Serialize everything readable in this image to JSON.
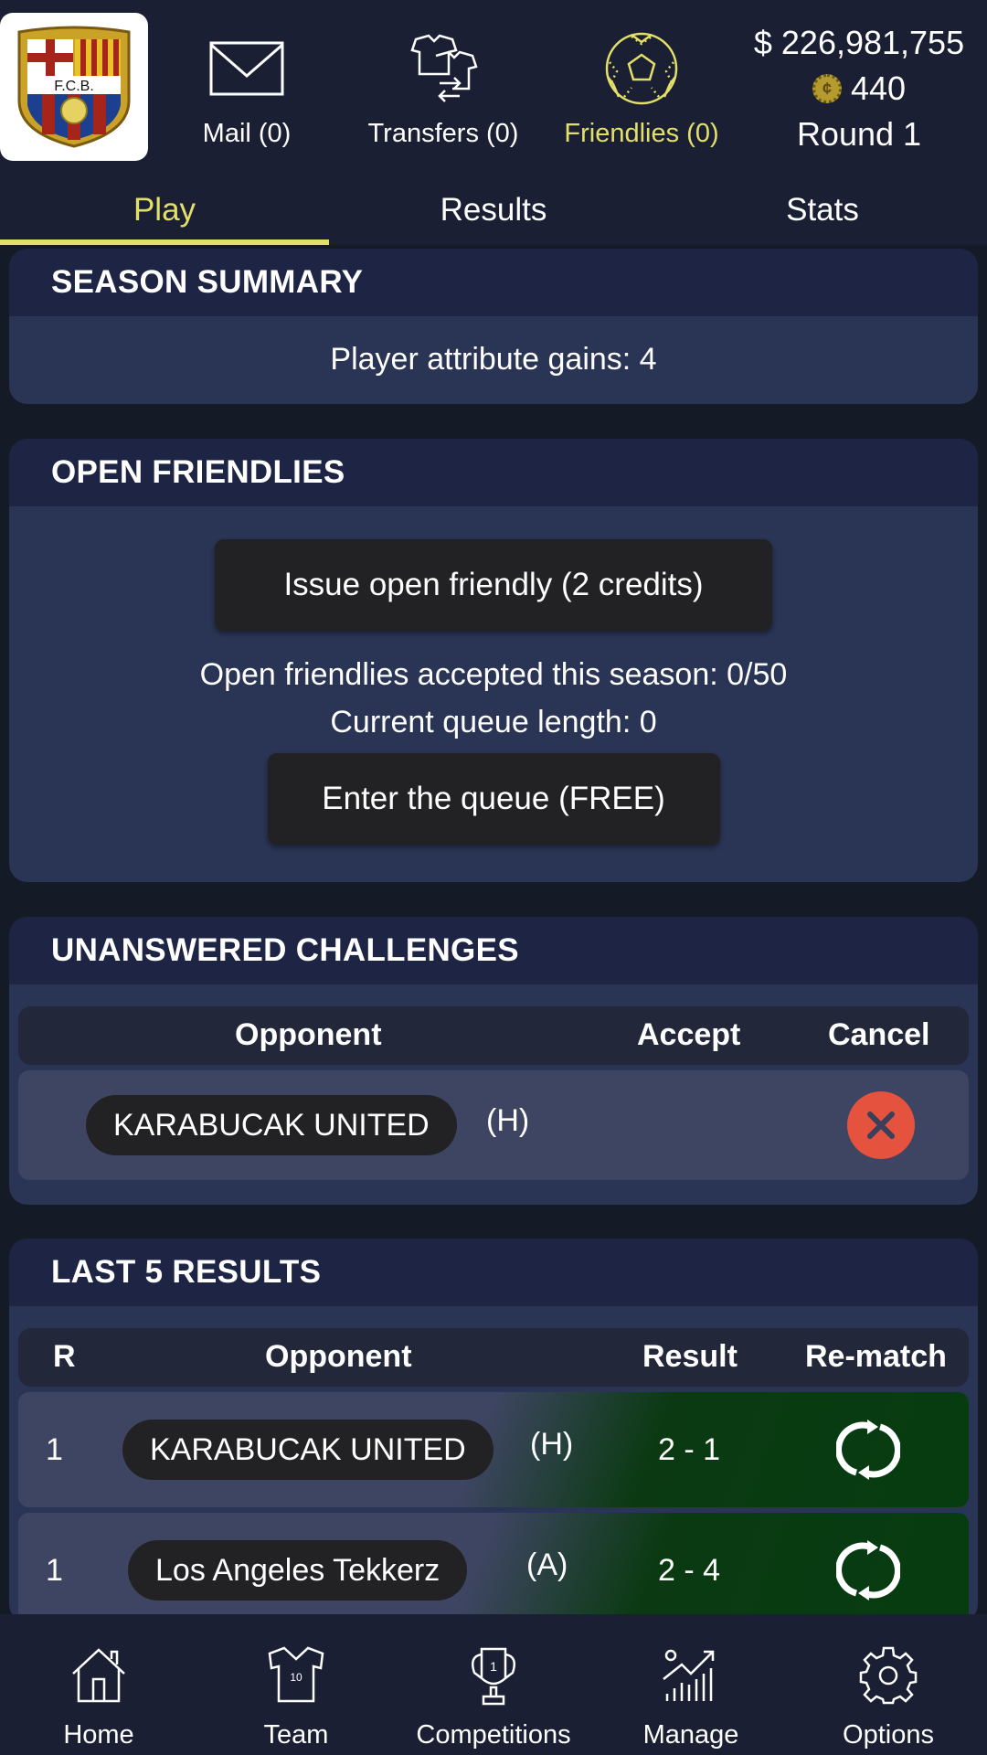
{
  "header": {
    "club_crest_text": "F.C.B.",
    "mail_label": "Mail (0)",
    "transfers_label": "Transfers (0)",
    "friendlies_label": "Friendlies (0)",
    "money": "$ 226,981,755",
    "credits": "440",
    "coin_symbol": "¢",
    "round": "Round 1"
  },
  "tabs": [
    {
      "label": "Play",
      "active": true
    },
    {
      "label": "Results",
      "active": false
    },
    {
      "label": "Stats",
      "active": false
    }
  ],
  "season_summary": {
    "title": "SEASON SUMMARY",
    "text": "Player attribute gains: 4"
  },
  "open_friendlies": {
    "title": "OPEN FRIENDLIES",
    "issue_button": "Issue open friendly (2 credits)",
    "accepted_text": "Open friendlies accepted this season: 0/50",
    "queue_text": "Current queue length: 0",
    "enter_queue_button": "Enter the queue (FREE)"
  },
  "unanswered_challenges": {
    "title": "UNANSWERED CHALLENGES",
    "columns": [
      "Opponent",
      "Accept",
      "Cancel"
    ],
    "rows": [
      {
        "opponent": "KARABUCAK UNITED",
        "venue": "(H)"
      }
    ]
  },
  "last_results": {
    "title": "LAST 5 RESULTS",
    "columns": [
      "R",
      "Opponent",
      "Result",
      "Re-match"
    ],
    "rows": [
      {
        "round": "1",
        "opponent": "KARABUCAK UNITED",
        "venue": "(H)",
        "result": "2 - 1"
      },
      {
        "round": "1",
        "opponent": "Los Angeles Tekkerz",
        "venue": "(A)",
        "result": "2 - 4"
      }
    ]
  },
  "bottom_nav": [
    {
      "label": "Home",
      "icon": "home-icon"
    },
    {
      "label": "Team",
      "icon": "shirt-icon",
      "shirt_number": "10"
    },
    {
      "label": "Competitions",
      "icon": "trophy-icon",
      "trophy_number": "1"
    },
    {
      "label": "Manage",
      "icon": "chart-icon"
    },
    {
      "label": "Options",
      "icon": "gear-icon"
    }
  ],
  "colors": {
    "accent": "#e3e06a",
    "background": "#151a27",
    "card": "#2a3454",
    "card_header": "#1d2444",
    "cancel": "#e5523d",
    "win_green": "#063c10"
  }
}
